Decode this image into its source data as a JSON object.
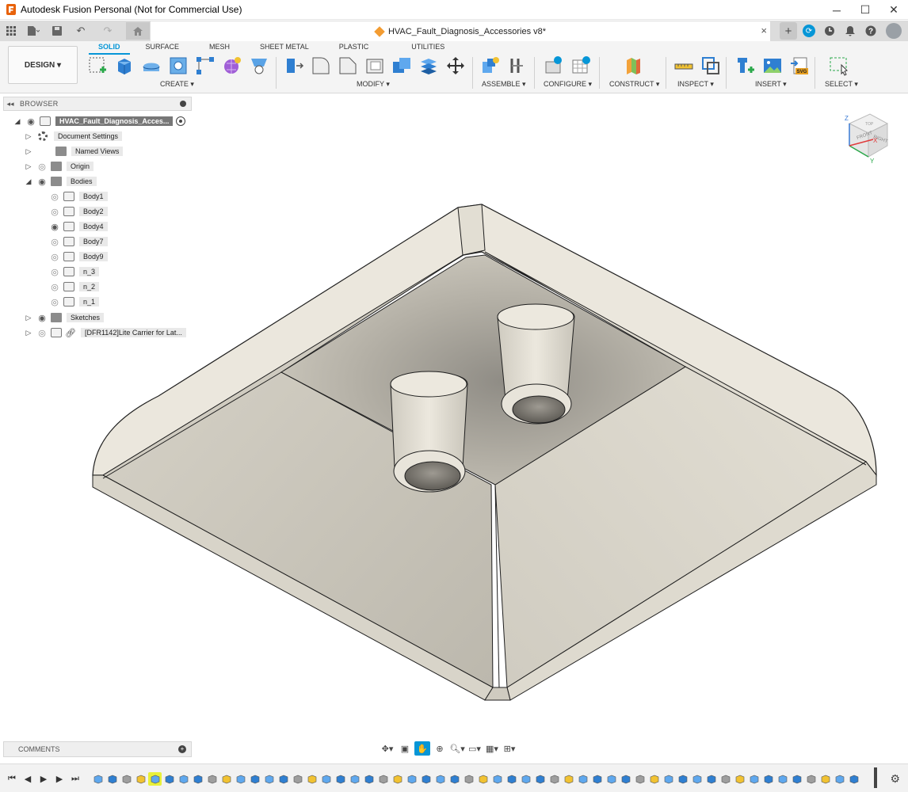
{
  "app": {
    "title": "Autodesk Fusion Personal (Not for Commercial Use)",
    "window_controls": [
      "─",
      "☐",
      "✕"
    ]
  },
  "tabbar": {
    "document_title": "HVAC_Fault_Diagnosis_Accessories v8*",
    "close_glyph": "×",
    "plus_glyph": "+",
    "online_glyph": "⟳"
  },
  "ribbon": {
    "workspace_button": "DESIGN ▾",
    "tabs": [
      "SOLID",
      "SURFACE",
      "MESH",
      "SHEET METAL",
      "PLASTIC",
      "UTILITIES"
    ],
    "active_tab": "SOLID",
    "groups": [
      "CREATE ▾",
      "MODIFY ▾",
      "ASSEMBLE ▾",
      "CONFIGURE ▾",
      "CONSTRUCT ▾",
      "INSPECT ▾",
      "INSERT ▾",
      "SELECT ▾"
    ]
  },
  "browser": {
    "header": "BROWSER",
    "collapse_glyph": "◂◂",
    "root": "HVAC_Fault_Diagnosis_Acces...",
    "items": [
      {
        "label": "Document Settings"
      },
      {
        "label": "Named Views"
      },
      {
        "label": "Origin"
      },
      {
        "label": "Bodies"
      },
      {
        "label": "Body1"
      },
      {
        "label": "Body2"
      },
      {
        "label": "Body4"
      },
      {
        "label": "Body7"
      },
      {
        "label": "Body9"
      },
      {
        "label": "n_3"
      },
      {
        "label": "n_2"
      },
      {
        "label": "n_1"
      },
      {
        "label": "Sketches"
      },
      {
        "label": "[DFR1142]Lite Carrier for Lat..."
      }
    ]
  },
  "viewcube": {
    "top_label": "TOP",
    "front_label": "FRONT",
    "right_label": "RIGHT",
    "z_label": "Z",
    "x_label": "X",
    "y_label": "Y"
  },
  "comments": {
    "label": "COMMENTS",
    "plus": "+"
  },
  "colors": {
    "accent": "#0696d7",
    "model_face": "#e8e4d8",
    "model_edge": "#222222",
    "brand_orange": "#e8620a"
  }
}
